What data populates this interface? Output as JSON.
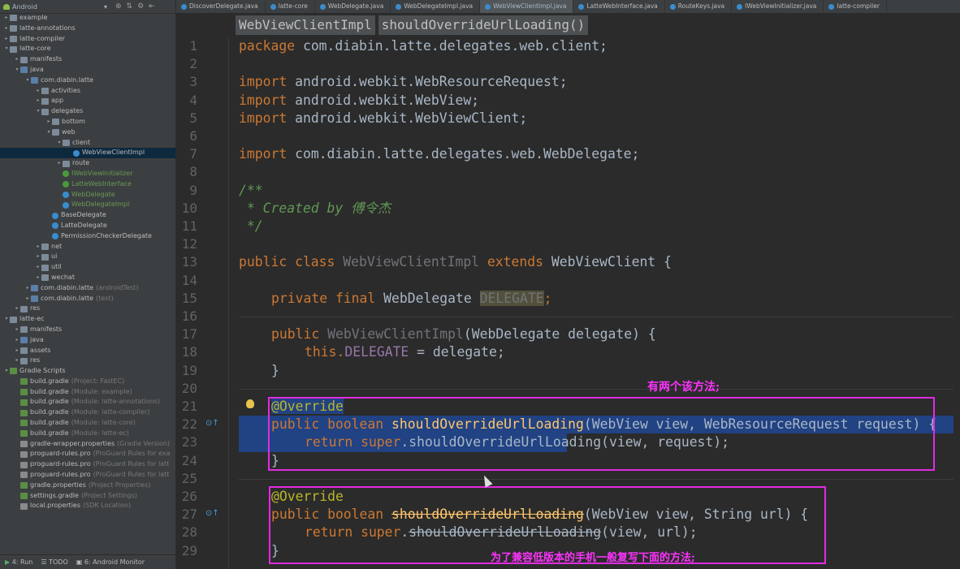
{
  "sidebar": {
    "view_selector": "Android",
    "tree": [
      {
        "indent": 0,
        "arrow": "▸",
        "icon": "folder",
        "label": "example"
      },
      {
        "indent": 0,
        "arrow": "▸",
        "icon": "folder",
        "label": "latte-annotations"
      },
      {
        "indent": 0,
        "arrow": "▸",
        "icon": "folder",
        "label": "latte-compiler"
      },
      {
        "indent": 0,
        "arrow": "▾",
        "icon": "folder",
        "label": "latte-core"
      },
      {
        "indent": 1,
        "arrow": "▸",
        "icon": "folder",
        "label": "manifests"
      },
      {
        "indent": 1,
        "arrow": "▾",
        "icon": "folder",
        "label": "java"
      },
      {
        "indent": 2,
        "arrow": "▾",
        "icon": "folder",
        "label": "com.diabin.latte"
      },
      {
        "indent": 3,
        "arrow": "▸",
        "icon": "folder",
        "label": "activities"
      },
      {
        "indent": 3,
        "arrow": "▸",
        "icon": "folder",
        "label": "app"
      },
      {
        "indent": 3,
        "arrow": "▾",
        "icon": "folder",
        "label": "delegates"
      },
      {
        "indent": 4,
        "arrow": "▸",
        "icon": "folder",
        "label": "bottom"
      },
      {
        "indent": 4,
        "arrow": "▾",
        "icon": "folder",
        "label": "web"
      },
      {
        "indent": 5,
        "arrow": "▾",
        "icon": "folder",
        "label": "client"
      },
      {
        "indent": 6,
        "arrow": "",
        "icon": "cls",
        "label": "WebViewClientImpl",
        "selected": true
      },
      {
        "indent": 5,
        "arrow": "▸",
        "icon": "folder",
        "label": "route"
      },
      {
        "indent": 5,
        "arrow": "",
        "icon": "iface",
        "label": "IWebViewInitializer",
        "green": true
      },
      {
        "indent": 5,
        "arrow": "",
        "icon": "iface",
        "label": "LatteWebInterface",
        "green": true
      },
      {
        "indent": 5,
        "arrow": "",
        "icon": "cls",
        "label": "WebDelegate",
        "green": true
      },
      {
        "indent": 5,
        "arrow": "",
        "icon": "cls",
        "label": "WebDelegateImpl",
        "green": true
      },
      {
        "indent": 4,
        "arrow": "",
        "icon": "cls",
        "label": "BaseDelegate"
      },
      {
        "indent": 4,
        "arrow": "",
        "icon": "cls",
        "label": "LatteDelegate"
      },
      {
        "indent": 4,
        "arrow": "",
        "icon": "cls",
        "label": "PermissionCheckerDelegate"
      },
      {
        "indent": 3,
        "arrow": "▸",
        "icon": "folder",
        "label": "net"
      },
      {
        "indent": 3,
        "arrow": "▸",
        "icon": "folder",
        "label": "ui"
      },
      {
        "indent": 3,
        "arrow": "▸",
        "icon": "folder",
        "label": "util"
      },
      {
        "indent": 3,
        "arrow": "▸",
        "icon": "folder",
        "label": "wechat"
      },
      {
        "indent": 2,
        "arrow": "▸",
        "icon": "folder",
        "label": "com.diabin.latte",
        "hint": "(androidTest)"
      },
      {
        "indent": 2,
        "arrow": "▸",
        "icon": "folder",
        "label": "com.diabin.latte",
        "hint": "(test)"
      },
      {
        "indent": 1,
        "arrow": "▸",
        "icon": "folder",
        "label": "res"
      },
      {
        "indent": 0,
        "arrow": "▾",
        "icon": "folder",
        "label": "latte-ec"
      },
      {
        "indent": 1,
        "arrow": "▸",
        "icon": "folder",
        "label": "manifests"
      },
      {
        "indent": 1,
        "arrow": "▸",
        "icon": "folder",
        "label": "java"
      },
      {
        "indent": 1,
        "arrow": "▸",
        "icon": "folder",
        "label": "assets"
      },
      {
        "indent": 1,
        "arrow": "▸",
        "icon": "folder",
        "label": "res"
      },
      {
        "indent": 0,
        "arrow": "▾",
        "icon": "gradle",
        "label": "Gradle Scripts"
      },
      {
        "indent": 1,
        "arrow": "",
        "icon": "gradle",
        "label": "build.gradle",
        "hint": "(Project: FastEC)"
      },
      {
        "indent": 1,
        "arrow": "",
        "icon": "gradle",
        "label": "build.gradle",
        "hint": "(Module: example)"
      },
      {
        "indent": 1,
        "arrow": "",
        "icon": "gradle",
        "label": "build.gradle",
        "hint": "(Module: latte-annotations)"
      },
      {
        "indent": 1,
        "arrow": "",
        "icon": "gradle",
        "label": "build.gradle",
        "hint": "(Module: latte-compiler)"
      },
      {
        "indent": 1,
        "arrow": "",
        "icon": "gradle",
        "label": "build.gradle",
        "hint": "(Module: latte-core)"
      },
      {
        "indent": 1,
        "arrow": "",
        "icon": "gradle",
        "label": "build.gradle",
        "hint": "(Module: latte-ec)"
      },
      {
        "indent": 1,
        "arrow": "",
        "icon": "file",
        "label": "gradle-wrapper.properties",
        "hint": "(Gradle Version)"
      },
      {
        "indent": 1,
        "arrow": "",
        "icon": "file",
        "label": "proguard-rules.pro",
        "hint": "(ProGuard Rules for exa"
      },
      {
        "indent": 1,
        "arrow": "",
        "icon": "file",
        "label": "proguard-rules.pro",
        "hint": "(ProGuard Rules for latt"
      },
      {
        "indent": 1,
        "arrow": "",
        "icon": "file",
        "label": "proguard-rules.pro",
        "hint": "(ProGuard Rules for latt"
      },
      {
        "indent": 1,
        "arrow": "",
        "icon": "gradle",
        "label": "gradle.properties",
        "hint": "(Project Properties)"
      },
      {
        "indent": 1,
        "arrow": "",
        "icon": "gradle",
        "label": "settings.gradle",
        "hint": "(Project Settings)"
      },
      {
        "indent": 1,
        "arrow": "",
        "icon": "file",
        "label": "local.properties",
        "hint": "(SDK Location)"
      }
    ],
    "bottom": {
      "run": "4: Run",
      "todo": "TODO",
      "monitor": "6: Android Monitor"
    }
  },
  "tabs": [
    {
      "label": "DiscoverDelegate.java"
    },
    {
      "label": "latte-core"
    },
    {
      "label": "WebDelegate.java"
    },
    {
      "label": "WebDelegateImpl.java"
    },
    {
      "label": "WebViewClientImpl.java",
      "active": true
    },
    {
      "label": "LatteWebInterface.java"
    },
    {
      "label": "RouteKeys.java"
    },
    {
      "label": "IWebViewInitializer.java"
    },
    {
      "label": "latte-compiler"
    }
  ],
  "breadcrumb": [
    "WebViewClientImpl",
    "shouldOverrideUrlLoading()"
  ],
  "code": {
    "line_numbers": [
      "1",
      "2",
      "3",
      "4",
      "5",
      "6",
      "7",
      "8",
      "9",
      "10",
      "11",
      "12",
      "13",
      "14",
      "15",
      "16",
      "17",
      "18",
      "19",
      "20",
      "21",
      "22",
      "23",
      "24",
      "25",
      "26",
      "27",
      "28",
      "29"
    ],
    "l1": {
      "kw": "package",
      "rest": " com.diabin.latte.delegates.web.client;"
    },
    "l3": {
      "kw": "import",
      "rest": " android.webkit.WebResourceRequest;"
    },
    "l4": {
      "kw": "import",
      "rest": " android.webkit.WebView;"
    },
    "l5": {
      "kw": "import",
      "rest": " android.webkit.WebViewClient;"
    },
    "l7": {
      "kw": "import",
      "rest": " com.diabin.latte.delegates.web.WebDelegate;"
    },
    "l9": "/**",
    "l10": " * Created by 傅令杰",
    "l11": " */",
    "l13": {
      "kw1": "public class",
      "cls": "WebViewClientImpl",
      "kw2": "extends",
      "rest": "WebViewClient {"
    },
    "l15": {
      "kw": "private final",
      "type": "WebDelegate",
      "field": "DELEGATE",
      "semi": ";"
    },
    "l17": {
      "kw": "public",
      "name": "WebViewClientImpl",
      "rest": "(WebDelegate delegate) {"
    },
    "l18": {
      "kw": "this",
      "field": "DELEGATE",
      "rest": " = delegate;"
    },
    "l19": "}",
    "l21": "@Override",
    "l22": {
      "kw": "public boolean",
      "name": "shouldOverrideUrlLoading",
      "rest": "(WebView view, WebResourceRequest request) {"
    },
    "l23": {
      "kw": "return super",
      "dot": ".",
      "name": "shouldOverrideUrlLoading",
      "rest": "(view, request);"
    },
    "l24": "}",
    "l26": "@Override",
    "l27": {
      "kw": "public boolean",
      "name": "shouldOverrideUrlLoading",
      "rest": "(WebView view, String url) {"
    },
    "l28": {
      "kw": "return super",
      "dot": ".",
      "name": "shouldOverrideUrlLoading",
      "rest": "(view, url);"
    },
    "l29": "}"
  },
  "annotations": {
    "note1": "有两个该方法;",
    "note2": "为了兼容低版本的手机一般复写下面的方法;"
  }
}
